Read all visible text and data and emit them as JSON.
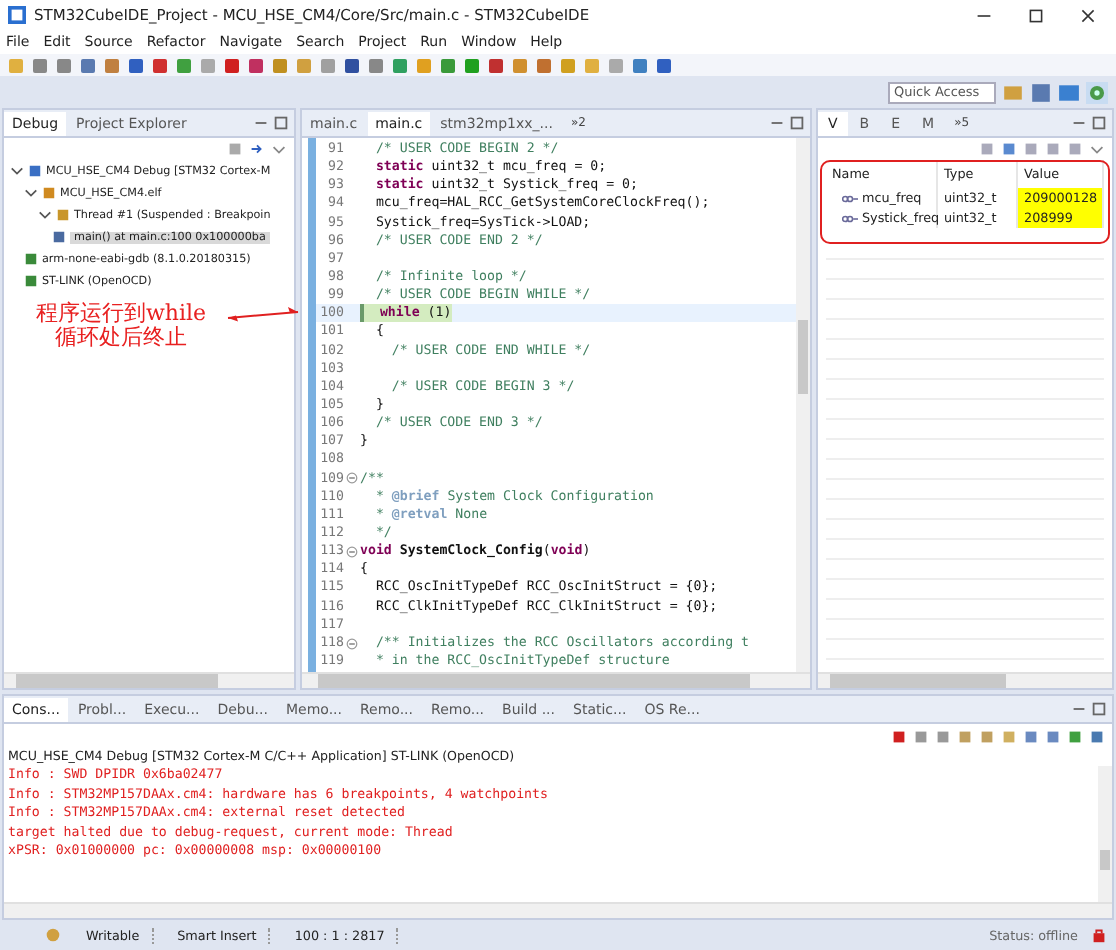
{
  "window": {
    "title": "STM32CubeIDE_Project - MCU_HSE_CM4/Core/Src/main.c - STM32CubeIDE"
  },
  "menu": [
    "File",
    "Edit",
    "Source",
    "Refactor",
    "Navigate",
    "Search",
    "Project",
    "Run",
    "Window",
    "Help"
  ],
  "quick_access": {
    "placeholder": "Quick Access"
  },
  "debug_view": {
    "tabs": [
      {
        "label": "Debug",
        "selected": true
      },
      {
        "label": "Project Explorer",
        "selected": false
      }
    ],
    "tree": [
      {
        "label": "MCU_HSE_CM4 Debug [STM32 Cortex-M",
        "kind": "launch",
        "expanded": true,
        "selected": false,
        "children": [
          {
            "label": "MCU_HSE_CM4.elf",
            "kind": "process",
            "expanded": true,
            "selected": false,
            "children": [
              {
                "label": "Thread #1 (Suspended : Breakpoin",
                "kind": "thread",
                "expanded": true,
                "selected": false,
                "children": [
                  {
                    "label": "main() at main.c:100 0x100000ba",
                    "kind": "frame",
                    "selected": true
                  }
                ]
              }
            ]
          },
          {
            "label": "arm-none-eabi-gdb (8.1.0.20180315)",
            "kind": "tool",
            "selected": false
          },
          {
            "label": "ST-LINK (OpenOCD)",
            "kind": "tool",
            "selected": false
          }
        ]
      }
    ]
  },
  "editor": {
    "tabs": [
      {
        "label": "main.c",
        "selected": false
      },
      {
        "label": "main.c",
        "selected": true
      },
      {
        "label": "stm32mp1xx_...",
        "selected": false
      }
    ],
    "overflow": "»2",
    "lines": [
      {
        "num": "91",
        "segs": [
          {
            "kind": "comment",
            "text": "  /* USER CODE BEGIN 2 */"
          }
        ]
      },
      {
        "num": "92",
        "segs": [
          {
            "kind": "kw",
            "text": "  static"
          },
          {
            "kind": "plain",
            "text": " uint32_t mcu_freq = 0;"
          }
        ]
      },
      {
        "num": "93",
        "segs": [
          {
            "kind": "kw",
            "text": "  static"
          },
          {
            "kind": "plain",
            "text": " uint32_t Systick_freq = 0;"
          }
        ]
      },
      {
        "num": "94",
        "segs": [
          {
            "kind": "plain",
            "text": "  mcu_freq=HAL_RCC_GetSystemCoreClockFreq();"
          }
        ]
      },
      {
        "num": "95",
        "segs": [
          {
            "kind": "plain",
            "text": "  Systick_freq=SysTick->LOAD;"
          }
        ]
      },
      {
        "num": "96",
        "segs": [
          {
            "kind": "comment",
            "text": "  /* USER CODE END 2 */"
          }
        ]
      },
      {
        "num": "97"
      },
      {
        "num": "98",
        "segs": [
          {
            "kind": "comment",
            "text": "  /* Infinite loop */"
          }
        ]
      },
      {
        "num": "99",
        "segs": [
          {
            "kind": "comment",
            "text": "  /* USER CODE BEGIN WHILE */"
          }
        ]
      },
      {
        "num": "100",
        "current": true,
        "segs": [
          {
            "kind": "kw",
            "text": "  while"
          },
          {
            "kind": "plain",
            "text": " (1)"
          }
        ]
      },
      {
        "num": "101",
        "segs": [
          {
            "kind": "plain",
            "text": "  {"
          }
        ]
      },
      {
        "num": "102",
        "segs": [
          {
            "kind": "comment",
            "text": "    /* USER CODE END WHILE */"
          }
        ]
      },
      {
        "num": "103"
      },
      {
        "num": "104",
        "segs": [
          {
            "kind": "comment",
            "text": "    /* USER CODE BEGIN 3 */"
          }
        ]
      },
      {
        "num": "105",
        "segs": [
          {
            "kind": "plain",
            "text": "  }"
          }
        ]
      },
      {
        "num": "106",
        "segs": [
          {
            "kind": "comment",
            "text": "  /* USER CODE END 3 */"
          }
        ]
      },
      {
        "num": "107",
        "segs": [
          {
            "kind": "plain",
            "text": "}"
          }
        ]
      },
      {
        "num": "108"
      },
      {
        "num": "109",
        "fold": true,
        "segs": [
          {
            "kind": "comment",
            "text": "/**"
          }
        ]
      },
      {
        "num": "110",
        "segs": [
          {
            "kind": "comment",
            "text": "  * "
          },
          {
            "kind": "doc",
            "text": "@brief"
          },
          {
            "kind": "comment",
            "text": " System Clock Configuration"
          }
        ]
      },
      {
        "num": "111",
        "segs": [
          {
            "kind": "comment",
            "text": "  * "
          },
          {
            "kind": "doc",
            "text": "@retval"
          },
          {
            "kind": "comment",
            "text": " None"
          }
        ]
      },
      {
        "num": "112",
        "segs": [
          {
            "kind": "comment",
            "text": "  */"
          }
        ]
      },
      {
        "num": "113",
        "fold": true,
        "segs": [
          {
            "kind": "kw",
            "text": "void"
          },
          {
            "kind": "fn",
            "text": " SystemClock_Config"
          },
          {
            "kind": "plain",
            "text": "("
          },
          {
            "kind": "kw",
            "text": "void"
          },
          {
            "kind": "plain",
            "text": ")"
          }
        ]
      },
      {
        "num": "114",
        "segs": [
          {
            "kind": "plain",
            "text": "{"
          }
        ]
      },
      {
        "num": "115",
        "segs": [
          {
            "kind": "plain",
            "text": "  RCC_OscInitTypeDef RCC_OscInitStruct = {0};"
          }
        ]
      },
      {
        "num": "116",
        "segs": [
          {
            "kind": "plain",
            "text": "  RCC_ClkInitTypeDef RCC_ClkInitStruct = {0};"
          }
        ]
      },
      {
        "num": "117"
      },
      {
        "num": "118",
        "fold": true,
        "segs": [
          {
            "kind": "comment",
            "text": "  /** Initializes the RCC Oscillators according t"
          }
        ]
      },
      {
        "num": "119",
        "segs": [
          {
            "kind": "comment",
            "text": "  * in the RCC_OscInitTypeDef structure"
          }
        ]
      }
    ]
  },
  "variables_view": {
    "tabs": [
      {
        "label": "V",
        "selected": true
      },
      {
        "label": "B",
        "selected": false
      },
      {
        "label": "E",
        "selected": false
      },
      {
        "label": "M",
        "selected": false
      }
    ],
    "overflow": "»5",
    "columns": [
      "Name",
      "Type",
      "Value"
    ],
    "rows": [
      {
        "name": "mcu_freq",
        "type": "uint32_t",
        "value": "209000128",
        "changed": true
      },
      {
        "name": "Systick_freq",
        "type": "uint32_t",
        "value": "208999",
        "changed": true
      }
    ]
  },
  "annotation": {
    "lines": [
      "程序运行到while",
      "循环处后终止"
    ]
  },
  "console": {
    "tabs": [
      {
        "label": "Cons...",
        "selected": true
      },
      {
        "label": "Probl...",
        "selected": false
      },
      {
        "label": "Execu...",
        "selected": false
      },
      {
        "label": "Debu...",
        "selected": false
      },
      {
        "label": "Memo...",
        "selected": false
      },
      {
        "label": "Remo...",
        "selected": false
      },
      {
        "label": "Remo...",
        "selected": false
      },
      {
        "label": "Build ...",
        "selected": false
      },
      {
        "label": "Static...",
        "selected": false
      },
      {
        "label": "OS Re...",
        "selected": false
      }
    ],
    "header": "MCU_HSE_CM4 Debug [STM32 Cortex-M C/C++ Application] ST-LINK (OpenOCD)",
    "lines": [
      "Info : SWD DPIDR 0x6ba02477",
      "Info : STM32MP157DAAx.cm4: hardware has 6 breakpoints, 4 watchpoints",
      "Info : STM32MP157DAAx.cm4: external reset detected",
      "target halted due to debug-request, current mode: Thread",
      "xPSR: 0x01000000 pc: 0x00000008 msp: 0x00000100"
    ]
  },
  "status_bar": {
    "mode": "Writable",
    "insert": "Smart Insert",
    "position": "100 : 1 : 2817",
    "connection": "Status: offline"
  }
}
